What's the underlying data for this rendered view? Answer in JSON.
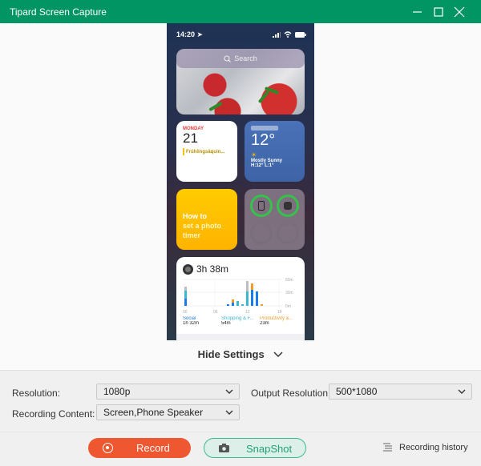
{
  "window": {
    "title": "Tipard Screen Capture",
    "controls": [
      "minimize",
      "maximize",
      "close"
    ]
  },
  "phone": {
    "status_time": "14:20",
    "search_placeholder": "Search",
    "calendar": {
      "day": "MONDAY",
      "date": "21",
      "event": "Frühlingsäquin..."
    },
    "weather": {
      "temp": "12°",
      "condition": "Mostly Sunny",
      "hilo": "H:12° L:1°"
    },
    "tip": {
      "line1": "How to",
      "line2": "set a photo",
      "line3": "timer"
    },
    "screen_time": {
      "total": "3h 38m",
      "axis_x": [
        "00",
        "06",
        "12",
        "18"
      ],
      "axis_y": [
        "60m",
        "30m",
        "0m"
      ],
      "categories": [
        {
          "name": "Social",
          "value": "1h 32m",
          "color": "#1a7ce8"
        },
        {
          "name": "Shopping & F...",
          "value": "54m",
          "color": "#3db6d4"
        },
        {
          "name": "Productivity &...",
          "value": "23m",
          "color": "#f39c2a"
        }
      ]
    }
  },
  "toggle": {
    "label": "Hide Settings"
  },
  "settings": {
    "resolution_label": "Resolution:",
    "resolution_value": "1080p",
    "output_resolution_label": "Output Resolution:",
    "output_resolution_value": "500*1080",
    "recording_content_label": "Recording Content:",
    "recording_content_value": "Screen,Phone Speaker"
  },
  "footer": {
    "record_label": "Record",
    "snapshot_label": "SnapShot",
    "history_label": "Recording history"
  },
  "colors": {
    "titlebar": "#009562",
    "record": "#ef5730",
    "snapshot_text": "#22a276"
  }
}
